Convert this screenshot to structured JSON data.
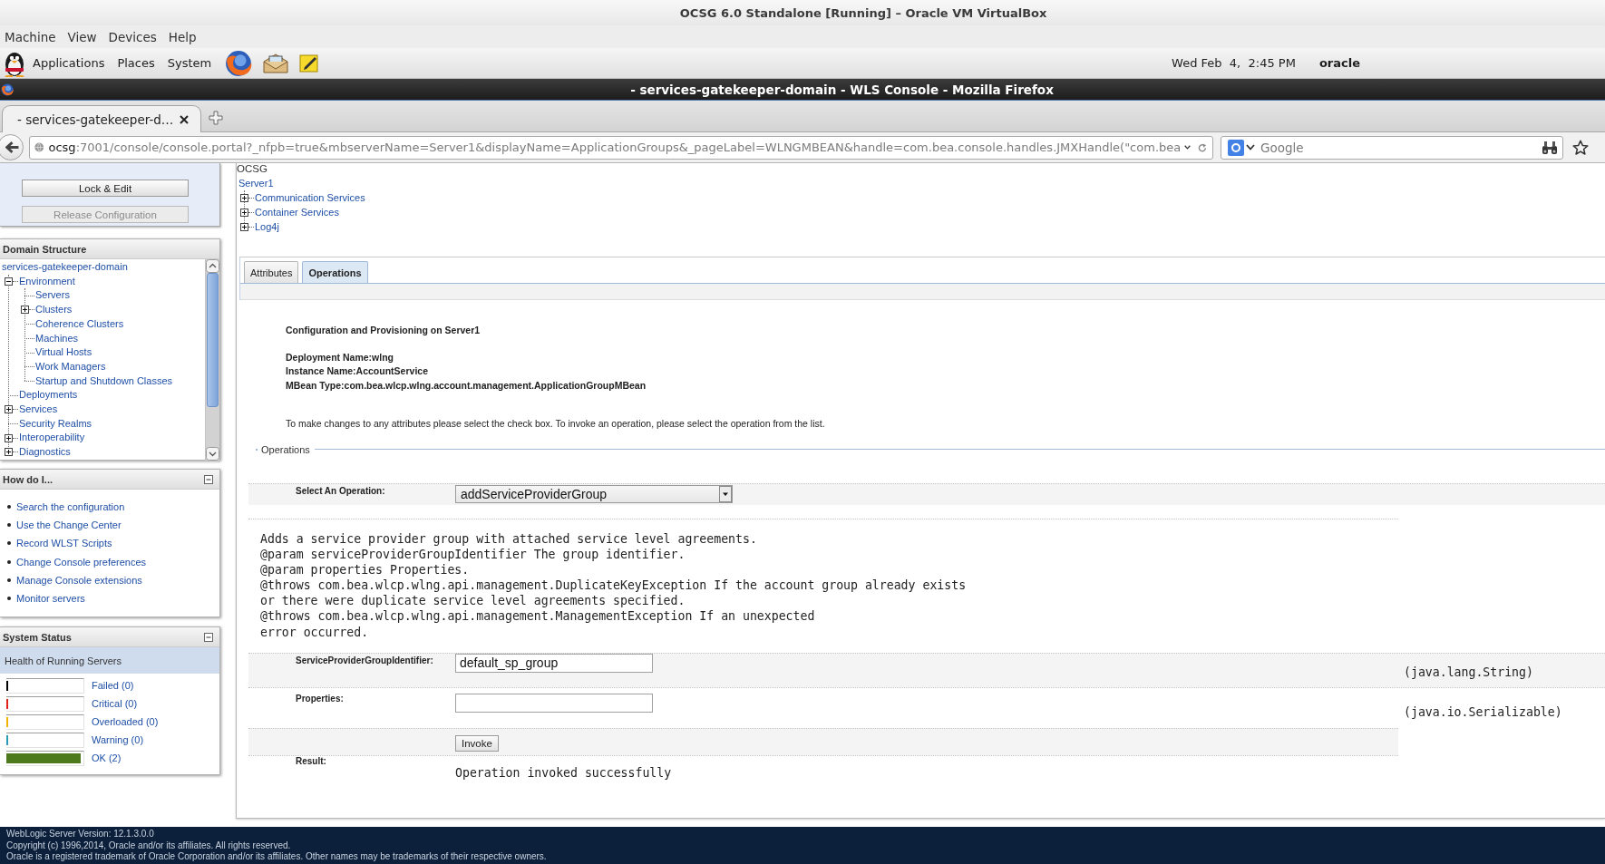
{
  "vm_window": {
    "title": "OCSG 6.0 Standalone [Running] – Oracle VM VirtualBox",
    "menu": [
      "Machine",
      "View",
      "Devices",
      "Help"
    ]
  },
  "desktop_panel": {
    "menus": [
      "Applications",
      "Places",
      "System"
    ],
    "clock": "Wed Feb  4,  2:45 PM",
    "user": "oracle"
  },
  "browser": {
    "title": "- services-gatekeeper-domain - WLS Console - Mozilla Firefox",
    "tabs": [
      {
        "label": "- services-gatekeeper-d…",
        "selected": true
      }
    ],
    "address": {
      "host": "ocsg",
      "path": ":7001/console/console.portal?_nfpb=true&mbserverName=Server1&displayName=ApplicationGroups&_pageLabel=WLNGMBEAN&handle=com.bea.console.handles.JMXHandle(\"com.bea"
    },
    "search": {
      "placeholder": "Google"
    }
  },
  "change_center": {
    "buttons": [
      {
        "label": "Lock & Edit",
        "disabled": false
      },
      {
        "label": "Release Configuration",
        "disabled": true
      }
    ]
  },
  "domain_structure": {
    "title": "Domain Structure",
    "root": {
      "label": "services-gatekeeper-domain",
      "children": [
        {
          "label": "Environment",
          "kind": "folder",
          "expanded": true,
          "children": [
            {
              "label": "Servers",
              "kind": "leaf"
            },
            {
              "label": "Clusters",
              "kind": "folder",
              "expanded": false
            },
            {
              "label": "Coherence Clusters",
              "kind": "leaf"
            },
            {
              "label": "Machines",
              "kind": "leaf"
            },
            {
              "label": "Virtual Hosts",
              "kind": "leaf"
            },
            {
              "label": "Work Managers",
              "kind": "leaf"
            },
            {
              "label": "Startup and Shutdown Classes",
              "kind": "leaf"
            }
          ]
        },
        {
          "label": "Deployments",
          "kind": "leaf"
        },
        {
          "label": "Services",
          "kind": "folder",
          "expanded": false
        },
        {
          "label": "Security Realms",
          "kind": "leaf"
        },
        {
          "label": "Interoperability",
          "kind": "folder",
          "expanded": false
        },
        {
          "label": "Diagnostics",
          "kind": "folder",
          "expanded": false
        }
      ]
    }
  },
  "how_do_i": {
    "title": "How do I...",
    "links": [
      "Search the configuration",
      "Use the Change Center",
      "Record WLST Scripts",
      "Change Console preferences",
      "Manage Console extensions",
      "Monitor servers"
    ]
  },
  "system_status": {
    "title": "System Status",
    "subtitle": "Health of Running Servers",
    "rows": [
      {
        "label": "Failed (0)",
        "level": 0,
        "color": "#000000"
      },
      {
        "label": "Critical (0)",
        "level": 0,
        "color": "#e0201a"
      },
      {
        "label": "Overloaded (0)",
        "level": 0,
        "color": "#f2b400"
      },
      {
        "label": "Warning (0)",
        "level": 0,
        "color": "#2a9bb5"
      },
      {
        "label": "OK (2)",
        "level": 1,
        "color": "#4d7a1d"
      }
    ]
  },
  "content": {
    "breadcrumb": "OCSG",
    "server_tree": {
      "label": "Server1",
      "children": [
        {
          "label": "Communication Services",
          "expanded": false
        },
        {
          "label": "Container Services",
          "expanded": false
        },
        {
          "label": "Log4j",
          "expanded": false
        }
      ]
    },
    "tabs": [
      {
        "label": "Attributes",
        "selected": false
      },
      {
        "label": "Operations",
        "selected": true
      }
    ],
    "heading": "Configuration and Provisioning on Server1",
    "details": [
      "Deployment Name:wlng",
      "Instance Name:AccountService",
      "MBean Type:com.bea.wlcp.wlng.account.management.ApplicationGroupMBean"
    ],
    "instructions": "To make changes to any attributes please select the check box. To invoke an operation, please select the operation from the list.",
    "section": "Operations",
    "operation": {
      "label": "Select An Operation:",
      "value": "addServiceProviderGroup"
    },
    "description": [
      "Adds a service provider group with attached service level agreements.",
      "@param serviceProviderGroupIdentifier The group identifier.",
      "@param properties Properties.",
      "@throws com.bea.wlcp.wlng.api.management.DuplicateKeyException If the account group already exists",
      "or there were duplicate service level agreements specified.",
      "@throws com.bea.wlcp.wlng.api.management.ManagementException If an unexpected",
      "error occurred."
    ],
    "parameters": [
      {
        "label": "ServiceProviderGroupIdentifier:",
        "value": "default_sp_group",
        "type": "(java.lang.String)"
      },
      {
        "label": "Properties:",
        "type": "(java.io.Serializable)"
      }
    ],
    "invoke_button": "Invoke",
    "result": {
      "label": "Result:",
      "value": "Operation invoked successfully"
    }
  },
  "footer": [
    "WebLogic Server Version: 12.1.3.0.0",
    "Copyright (c) 1996,2014, Oracle and/or its affiliates. All rights reserved.",
    "Oracle is a registered trademark of Oracle Corporation and/or its affiliates. Other names may be trademarks of their respective owners."
  ]
}
